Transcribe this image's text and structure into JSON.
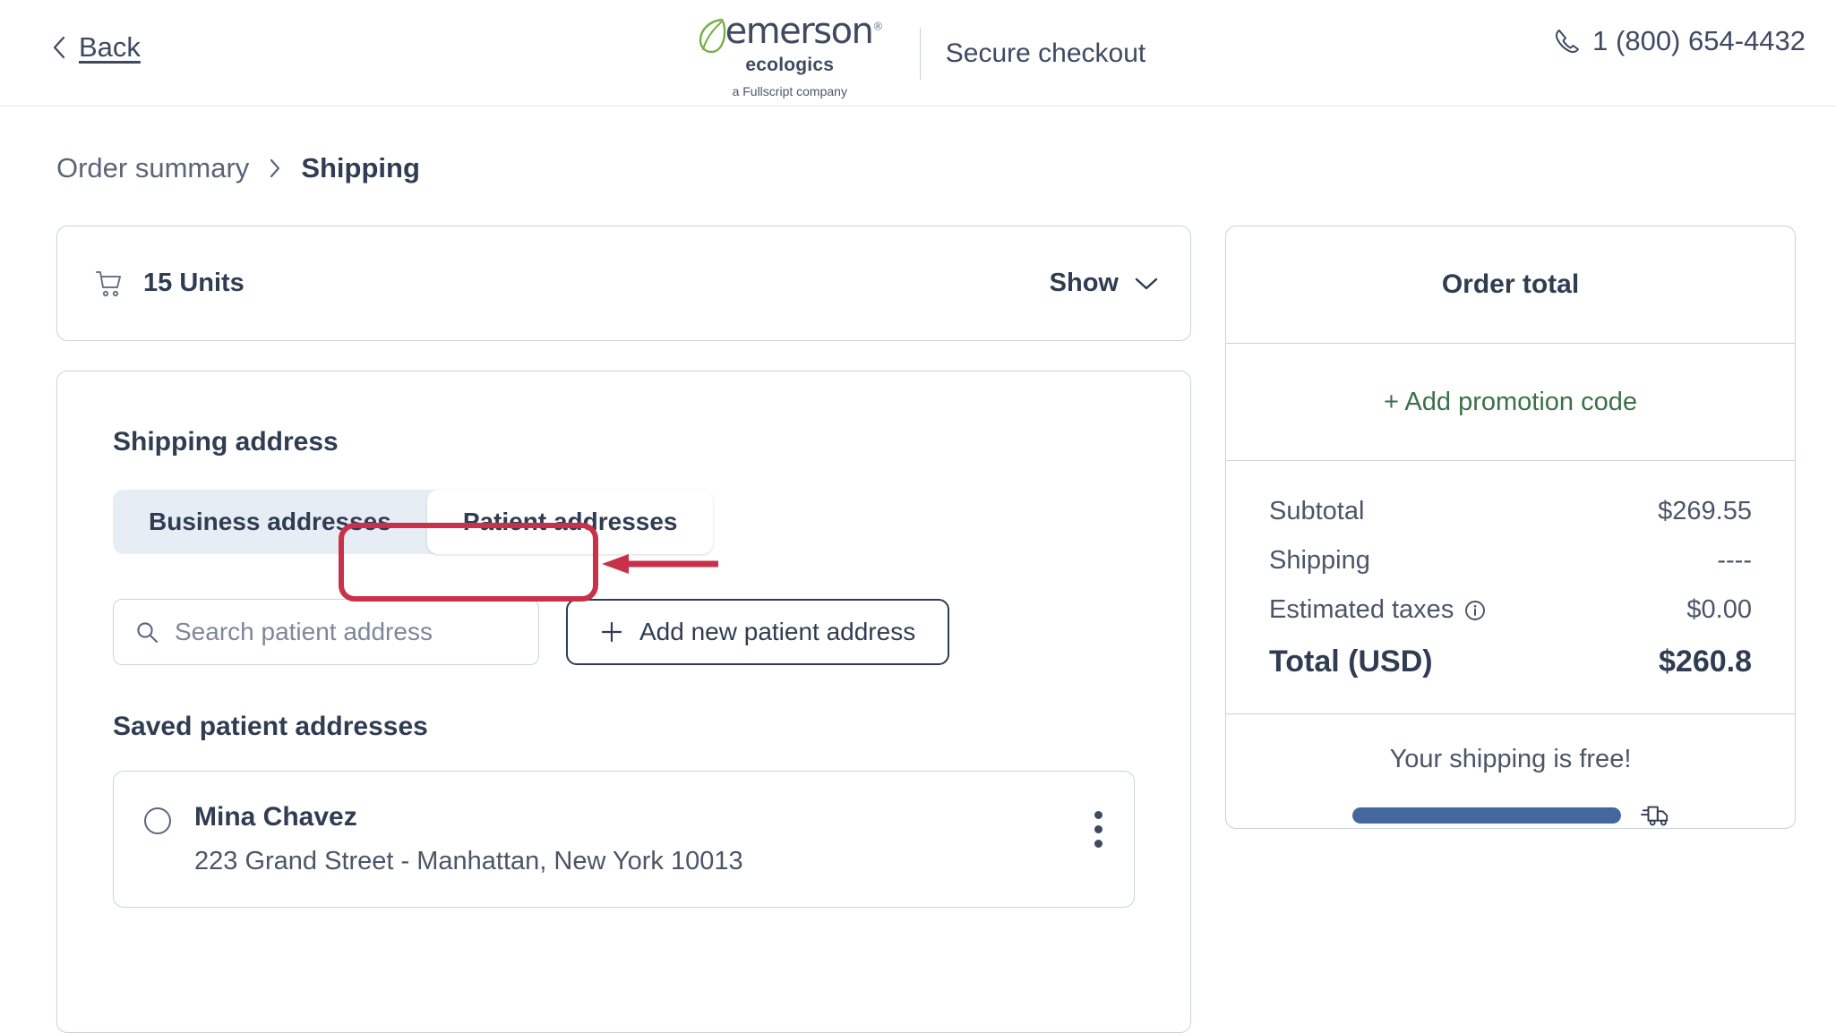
{
  "header": {
    "back_label": "Back",
    "back_icon": "chevron-left-icon",
    "logo": {
      "word": "emerson",
      "registered": "®",
      "sub": "ecologics",
      "tagline": "a Fullscript company",
      "leaf_icon": "leaf-icon",
      "leaf_color": "#76b043",
      "word_color": "#3d4a60"
    },
    "secure_text": "Secure checkout",
    "phone_icon": "phone-icon",
    "phone": "1 (800) 654-4432"
  },
  "breadcrumb": {
    "previous": "Order summary",
    "separator_icon": "chevron-right-icon",
    "current": "Shipping"
  },
  "cart": {
    "icon": "shopping-cart-icon",
    "units": "15 Units",
    "show_label": "Show",
    "show_icon": "chevron-down-icon"
  },
  "shipping": {
    "section_title": "Shipping address",
    "tabs": [
      {
        "label": "Business addresses",
        "active": false
      },
      {
        "label": "Patient addresses",
        "active": true
      }
    ],
    "search": {
      "icon": "search-icon",
      "placeholder": "Search patient address",
      "value": ""
    },
    "add_button": {
      "icon": "plus-icon",
      "label": "Add new patient address"
    },
    "saved_title": "Saved patient addresses",
    "addresses": [
      {
        "name": "Mina Chavez",
        "line": "223 Grand Street - Manhattan, New York 10013",
        "selected": false,
        "menu_icon": "kebab-menu-icon"
      }
    ]
  },
  "annotation": {
    "type": "arrow-callout",
    "color": "#c9304a",
    "target": "Patient addresses"
  },
  "order_total": {
    "title": "Order total",
    "promo_label": "+ Add promotion code",
    "promo_color": "#3a7146",
    "lines": [
      {
        "label": "Subtotal",
        "value": "$269.55",
        "info": false
      },
      {
        "label": "Shipping",
        "value": "----",
        "info": false
      },
      {
        "label": "Estimated taxes",
        "value": "$0.00",
        "info": true,
        "info_icon": "info-circle-icon"
      }
    ],
    "total_label": "Total (USD)",
    "total_value": "$260.8",
    "free_shipping_message": "Your shipping is free!",
    "progress_percent": 100,
    "progress_color": "#43679e",
    "truck_icon": "delivery-truck-icon"
  }
}
